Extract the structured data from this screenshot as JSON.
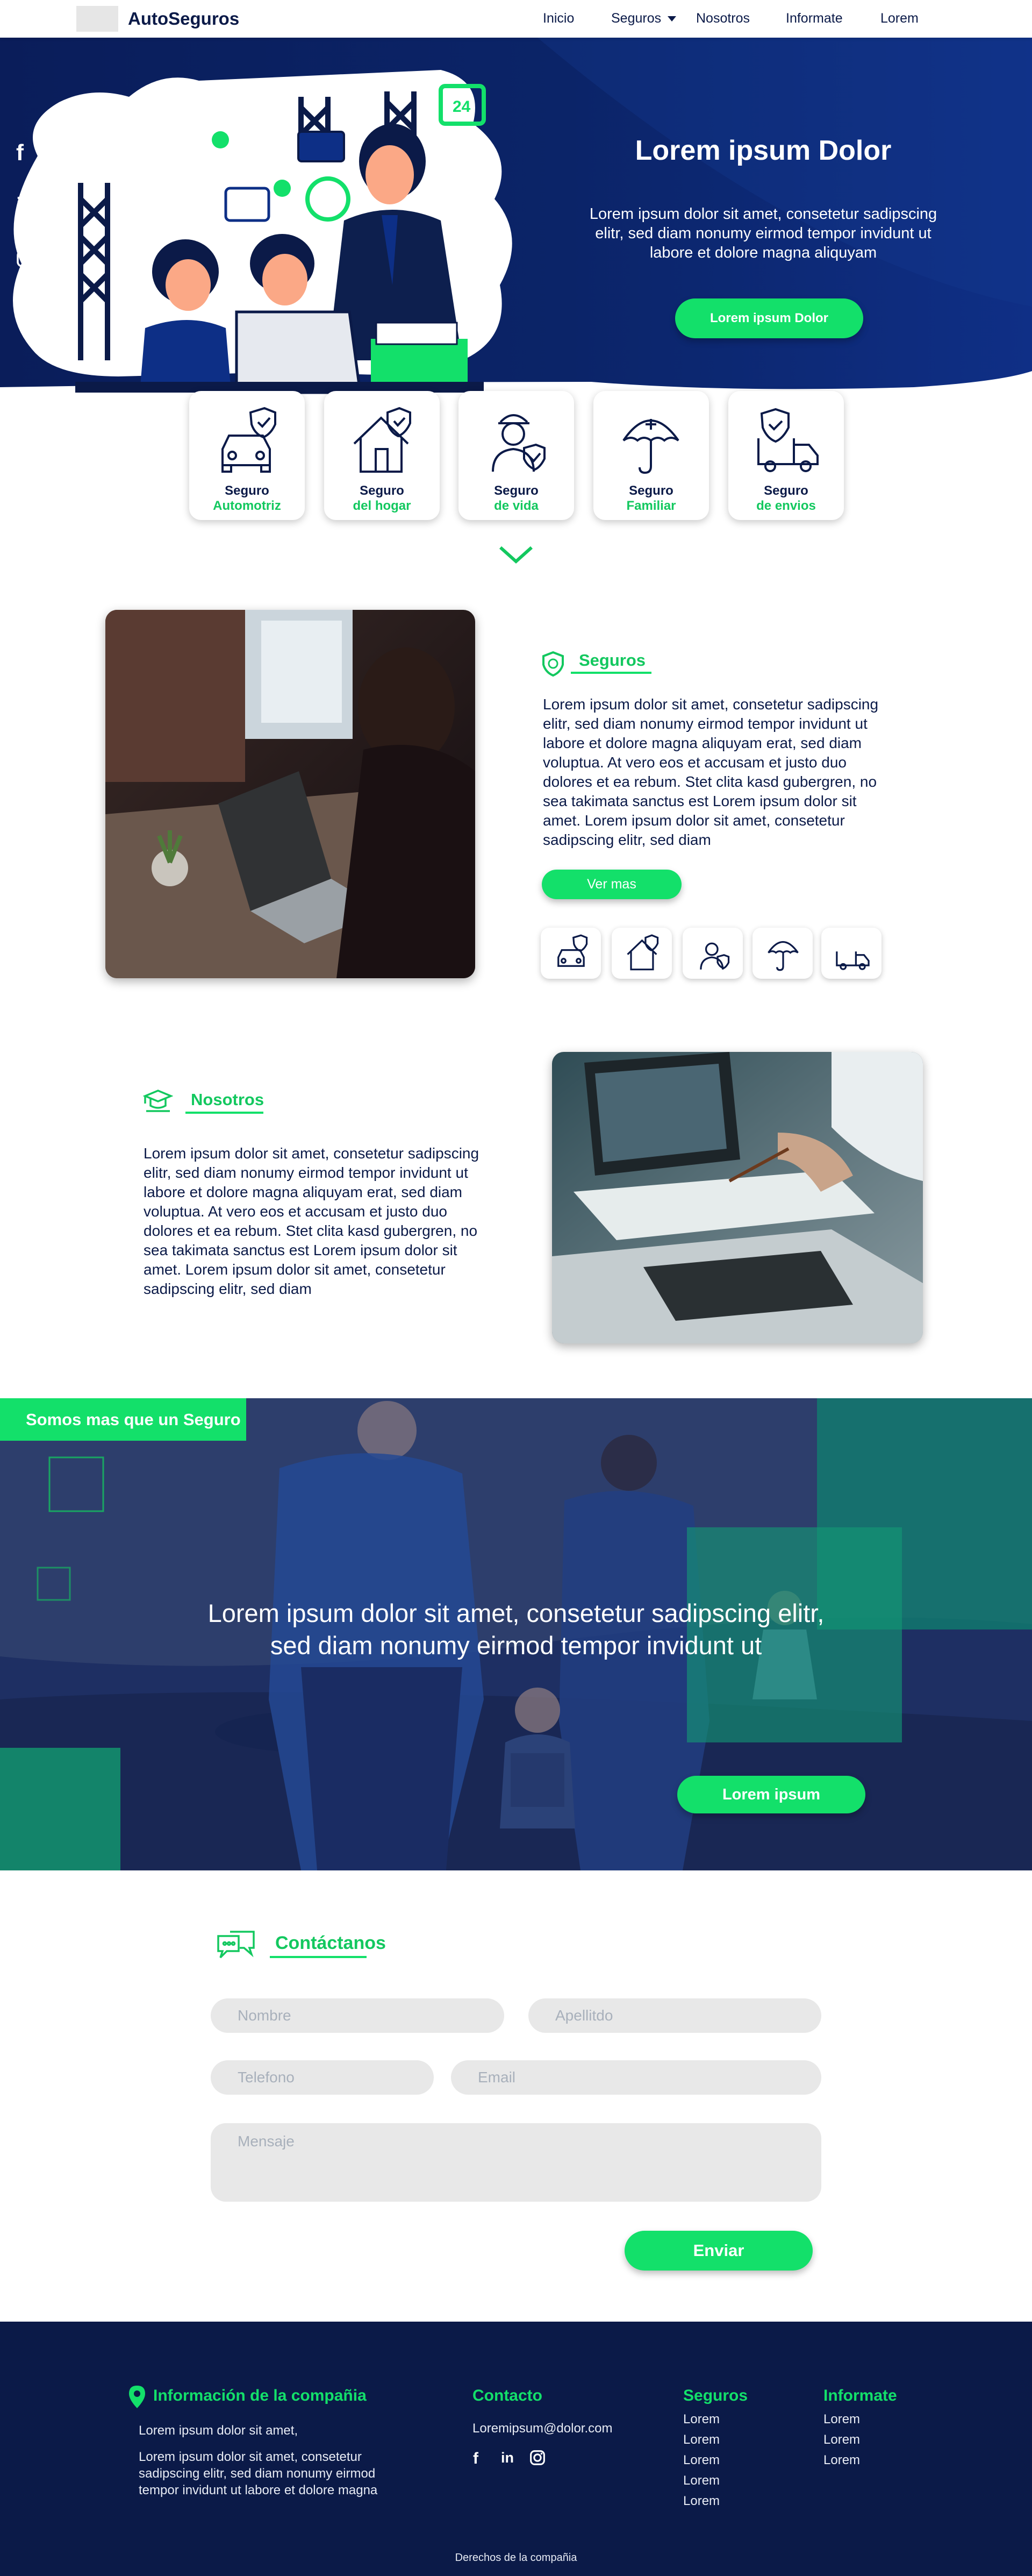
{
  "nav": {
    "brand": "AutoSeguros",
    "items": [
      "Inicio",
      "Seguros",
      "Nosotros",
      "Informate",
      "Lorem"
    ]
  },
  "colors": {
    "navy": "#0b1a48",
    "green": "#13e06a",
    "hero_blue": "#0d2f86"
  },
  "hero": {
    "social": [
      "facebook-icon",
      "linkedin-icon",
      "instagram-icon"
    ],
    "title": "Lorem ipsum Dolor",
    "text": "Lorem ipsum dolor sit amet, consetetur sadipscing elitr, sed diam nonumy eirmod tempor invidunt ut labore et dolore magna aliquyam",
    "button": "Lorem ipsum Dolor"
  },
  "insurance": [
    {
      "line1": "Seguro",
      "line2": "Automotriz",
      "icon": "car-shield-icon"
    },
    {
      "line1": "Seguro",
      "line2": "del hogar",
      "icon": "house-shield-icon"
    },
    {
      "line1": "Seguro",
      "line2": "de vida",
      "icon": "person-shield-icon"
    },
    {
      "line1": "Seguro",
      "line2": "Familiar",
      "icon": "umbrella-icon"
    },
    {
      "line1": "Seguro",
      "line2": "de envios",
      "icon": "truck-shield-icon"
    }
  ],
  "seguros": {
    "heading": "Seguros",
    "text": "Lorem ipsum dolor sit amet, consetetur sadipscing elitr, sed diam nonumy eirmod tempor invidunt ut labore et dolore magna aliquyam erat, sed diam voluptua. At vero eos et accusam et justo duo dolores et ea rebum. Stet clita kasd gubergren, no sea takimata sanctus est Lorem ipsum dolor sit amet. Lorem ipsum dolor sit amet, consetetur sadipscing elitr, sed diam",
    "button": "Ver mas"
  },
  "nosotros": {
    "heading": "Nosotros",
    "text": "Lorem ipsum dolor sit amet, consetetur sadipscing elitr, sed diam nonumy eirmod tempor invidunt ut labore et dolore magna aliquyam erat, sed diam voluptua. At vero eos et accusam et justo duo dolores et ea rebum. Stet clita kasd gubergren, no sea takimata sanctus est Lorem ipsum dolor sit amet. Lorem ipsum dolor sit amet, consetetur sadipscing elitr, sed diam"
  },
  "banner": {
    "tag": "Somos mas que un Seguro",
    "text": "Lorem ipsum dolor sit amet, consetetur sadipscing elitr, sed diam nonumy eirmod tempor invidunt ut",
    "button": "Lorem ipsum"
  },
  "contact": {
    "heading": "Contáctanos",
    "placeholders": {
      "nombre": "Nombre",
      "apellido": "Apellitdo",
      "telefono": "Telefono",
      "email": "Email",
      "mensaje": "Mensaje"
    },
    "submit": "Enviar"
  },
  "footer": {
    "info_heading": "Información de la compañia",
    "info_line1": "Lorem ipsum dolor sit amet,",
    "info_line2": "Lorem ipsum dolor sit amet, consetetur sadipscing elitr, sed diam nonumy eirmod tempor invidunt ut labore et dolore magna",
    "contact_heading": "Contacto",
    "email": "Loremipsum@dolor.com",
    "seguros_heading": "Seguros",
    "seguros_links": [
      "Lorem",
      "Lorem",
      "Lorem",
      "Lorem",
      "Lorem"
    ],
    "informate_heading": "Informate",
    "informate_links": [
      "Lorem",
      "Lorem",
      "Lorem"
    ],
    "copyright": "Derechos de la compañia"
  }
}
